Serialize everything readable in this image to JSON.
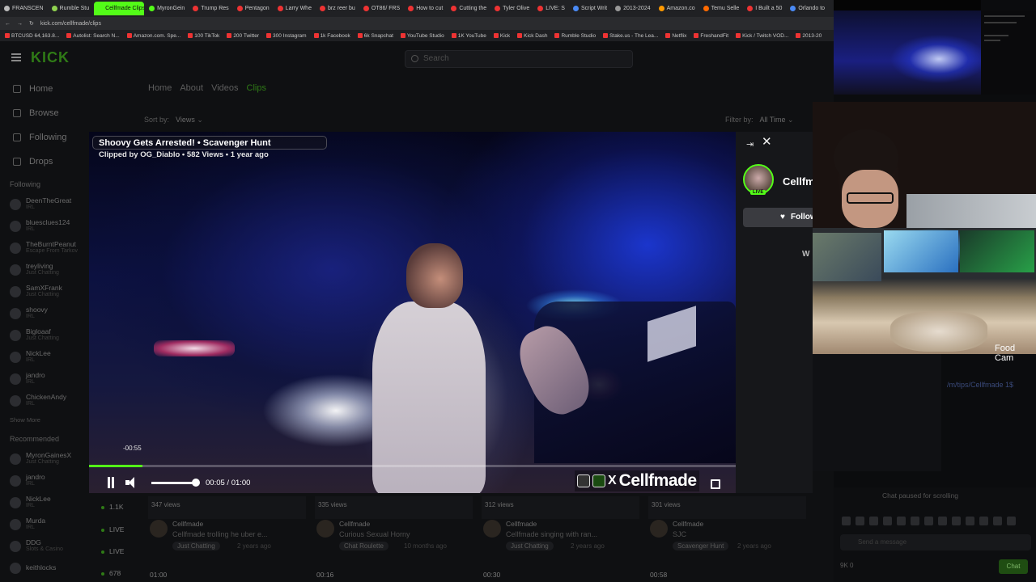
{
  "browser": {
    "tabs": [
      "FRANSCEN",
      "Rumble Stu",
      "Cellfmade Clips",
      "MyronGein",
      "Trump Res",
      "Pentagon",
      "Larry Whe",
      "brz reer bu",
      "OT86/ FRS",
      "How to cut",
      "Cutting the",
      "Tyler Olive",
      "LIVE: S",
      "Script Writ",
      "2013-2024",
      "Amazon.co",
      "Temu Selle",
      "I Built a 50",
      "Orlando to"
    ],
    "active_tab": 2,
    "url": "kick.com/cellfmade/clips",
    "bookmarks": [
      "BTCUSD 64,163.8...",
      "Autolist: Search N...",
      "Amazon.com. Spe...",
      "100 TikTok",
      "200 Twitter",
      "300 Instagram",
      "1k Facebook",
      "6k Snapchat",
      "YouTube Studio",
      "1K YouTube",
      "Kick",
      "Kick Dash",
      "Rumble Studio",
      "Stake.us - The Lea...",
      "Netflix",
      "FreshandFit",
      "Kick / Twitch VOD...",
      "2013-20"
    ]
  },
  "kick": {
    "logo": "KICK",
    "search_placeholder": "Search",
    "sidebar_nav": [
      "Home",
      "Browse",
      "Following",
      "Drops"
    ],
    "following_label": "Following",
    "following": [
      {
        "name": "DeenTheGreat",
        "cat": "IRL"
      },
      {
        "name": "bluesclues124",
        "cat": "IRL"
      },
      {
        "name": "TheBurntPeanut",
        "cat": "Escape From Tarkov"
      },
      {
        "name": "treyliving",
        "cat": "Just Chatting"
      },
      {
        "name": "SamXFrank",
        "cat": "Just Chatting"
      },
      {
        "name": "shoovy",
        "cat": "IRL"
      },
      {
        "name": "Bigloaaf",
        "cat": "Just Chatting"
      },
      {
        "name": "NickLee",
        "cat": "IRL"
      },
      {
        "name": "jandro",
        "cat": "IRL"
      },
      {
        "name": "ChickenAndy",
        "cat": "IRL"
      }
    ],
    "show_more": "Show More",
    "recommended_label": "Recommended",
    "recommended": [
      {
        "name": "MyronGainesX",
        "cat": "Just Chatting"
      },
      {
        "name": "jandro",
        "cat": "IRL"
      },
      {
        "name": "NickLee",
        "cat": "IRL"
      },
      {
        "name": "Murda",
        "cat": "IRL"
      },
      {
        "name": "DDG",
        "cat": "Slots & Casino"
      },
      {
        "name": "keithlocks",
        "cat": ""
      }
    ],
    "channel_tabs": [
      "Home",
      "About",
      "Videos",
      "Clips"
    ],
    "sort_label": "Sort by:",
    "sort_value": "Views",
    "filter_label": "Filter by:",
    "filter_value": "All Time",
    "left_live": [
      "1.1K",
      "LIVE",
      "LIVE",
      "678"
    ],
    "clips": [
      {
        "views": "347 views",
        "channel": "Cellfmade",
        "title": "Cellfmade trolling he uber e...",
        "tag": "Just Chatting",
        "age": "2 years ago",
        "dur": "01:00"
      },
      {
        "views": "335 views",
        "channel": "Cellfmade",
        "title": "Curious Sexual Horny",
        "tag": "Chat Roulette",
        "age": "10 months ago",
        "dur": "00:16"
      },
      {
        "views": "312 views",
        "channel": "Cellfmade",
        "title": "Cellfmade singing with ran...",
        "tag": "Just Chatting",
        "age": "2 years ago",
        "dur": "00:30"
      },
      {
        "views": "301 views",
        "channel": "Cellfmade",
        "title": "SJC",
        "tag": "Scavenger Hunt",
        "age": "2 years ago",
        "dur": "00:58"
      }
    ],
    "tips_link": "/m/tips/Cellfmade 1$",
    "chat_paused": "Chat paused for scrolling",
    "chat_placeholder": "Send a message",
    "chat_stats": "9K    0",
    "chat_button": "Chat"
  },
  "player": {
    "title": "Shoovy Gets Arrested! • Scavenger Hunt",
    "meta": "Clipped by OG_Diablo • 582 Views • 1 year ago",
    "remaining": "-00:55",
    "time": "00:05 / 01:00",
    "progress": 0.083,
    "volume": 0.9,
    "watermark": "Cellfmade",
    "watermark_x": "X"
  },
  "side_panel": {
    "channel": "Cellfmade",
    "live_badge": "LIVE",
    "follow_label": "Follow",
    "partial_label": "W"
  },
  "overlay": {
    "cam_label": "Food Cam"
  },
  "colors": {
    "accent": "#53fc18",
    "bg": "#0f1012"
  }
}
